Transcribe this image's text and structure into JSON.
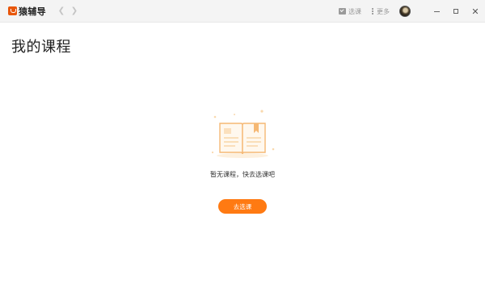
{
  "titlebar": {
    "app_name": "猿辅导",
    "tools": {
      "select_course_label": "选课",
      "more_label": "更多"
    }
  },
  "main": {
    "page_title": "我的课程",
    "empty_state": {
      "message": "暂无课程，快去选课吧",
      "button_label": "去选课"
    }
  },
  "colors": {
    "accent": "#ff7a12",
    "logo": "#e8570c",
    "illustration": "#f7c88a"
  },
  "icons": [
    "logo-icon",
    "back-arrow-icon",
    "forward-arrow-icon",
    "check-box-icon",
    "more-dots-icon",
    "minimize-icon",
    "maximize-icon",
    "close-icon",
    "open-book-icon"
  ]
}
